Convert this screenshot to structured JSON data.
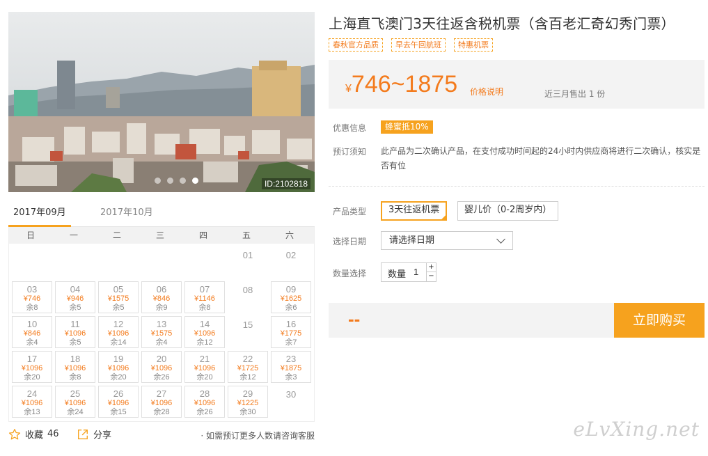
{
  "gallery": {
    "image_id": "ID:2102818",
    "slide_count": 4,
    "active_slide": 4
  },
  "calendar": {
    "tabs": [
      {
        "label": "2017年09月",
        "active": true
      },
      {
        "label": "2017年10月",
        "active": false
      }
    ],
    "weekdays": [
      "日",
      "一",
      "二",
      "三",
      "四",
      "五",
      "六"
    ],
    "days": [
      {
        "day": "",
        "price": "",
        "stock": ""
      },
      {
        "day": "",
        "price": "",
        "stock": ""
      },
      {
        "day": "",
        "price": "",
        "stock": ""
      },
      {
        "day": "",
        "price": "",
        "stock": ""
      },
      {
        "day": "",
        "price": "",
        "stock": ""
      },
      {
        "day": "01",
        "price": "",
        "stock": ""
      },
      {
        "day": "02",
        "price": "",
        "stock": ""
      },
      {
        "day": "03",
        "price": "¥746",
        "stock": "余8"
      },
      {
        "day": "04",
        "price": "¥946",
        "stock": "余5"
      },
      {
        "day": "05",
        "price": "¥1575",
        "stock": "余5"
      },
      {
        "day": "06",
        "price": "¥846",
        "stock": "余9"
      },
      {
        "day": "07",
        "price": "¥1146",
        "stock": "余8"
      },
      {
        "day": "08",
        "price": "",
        "stock": ""
      },
      {
        "day": "09",
        "price": "¥1625",
        "stock": "余6"
      },
      {
        "day": "10",
        "price": "¥846",
        "stock": "余4"
      },
      {
        "day": "11",
        "price": "¥1096",
        "stock": "余5"
      },
      {
        "day": "12",
        "price": "¥1096",
        "stock": "余14"
      },
      {
        "day": "13",
        "price": "¥1575",
        "stock": "余4"
      },
      {
        "day": "14",
        "price": "¥1096",
        "stock": "余12"
      },
      {
        "day": "15",
        "price": "",
        "stock": ""
      },
      {
        "day": "16",
        "price": "¥1775",
        "stock": "余7"
      },
      {
        "day": "17",
        "price": "¥1096",
        "stock": "余20"
      },
      {
        "day": "18",
        "price": "¥1096",
        "stock": "余8"
      },
      {
        "day": "19",
        "price": "¥1096",
        "stock": "余20"
      },
      {
        "day": "20",
        "price": "¥1096",
        "stock": "余26"
      },
      {
        "day": "21",
        "price": "¥1096",
        "stock": "余20"
      },
      {
        "day": "22",
        "price": "¥1725",
        "stock": "余12"
      },
      {
        "day": "23",
        "price": "¥1875",
        "stock": "余3"
      },
      {
        "day": "24",
        "price": "¥1096",
        "stock": "余13"
      },
      {
        "day": "25",
        "price": "¥1096",
        "stock": "余24"
      },
      {
        "day": "26",
        "price": "¥1096",
        "stock": "余15"
      },
      {
        "day": "27",
        "price": "¥1096",
        "stock": "余28"
      },
      {
        "day": "28",
        "price": "¥1096",
        "stock": "余26"
      },
      {
        "day": "29",
        "price": "¥1225",
        "stock": "余30"
      },
      {
        "day": "30",
        "price": "",
        "stock": ""
      }
    ]
  },
  "actions": {
    "favorite_label": "收藏",
    "favorite_count": "46",
    "share_label": "分享",
    "note": "· 如需预订更多人数请咨询客服"
  },
  "product": {
    "title": "上海直飞澳门3天往返含税机票（含百老汇奇幻秀门票）",
    "tags": [
      "春秋官方品质",
      "早去午回航班",
      "特惠机票"
    ],
    "price_currency": "¥",
    "price_range": "746~1875",
    "price_explain": "价格说明",
    "sold": "近三月售出 1 份"
  },
  "info": {
    "promo_label": "优惠信息",
    "promo_badge": "蜂蜜抵10%",
    "notice_label": "预订须知",
    "notice_text": "此产品为二次确认产品，在支付成功时间起的24小时内供应商将进行二次确认，核实是否有位"
  },
  "options": {
    "type_label": "产品类型",
    "types": [
      "3天往返机票",
      "婴儿价（0-2周岁内）"
    ],
    "date_label": "选择日期",
    "date_placeholder": "请选择日期",
    "qty_label": "数量选择",
    "qty_field_label": "数量",
    "qty_value": "1",
    "qty_plus": "+",
    "qty_minus": "−"
  },
  "buy": {
    "total": "--",
    "button": "立即购买"
  },
  "watermark": "eLvXing.net",
  "colors": {
    "accent": "#f6a21e",
    "price": "#f37b1d"
  }
}
